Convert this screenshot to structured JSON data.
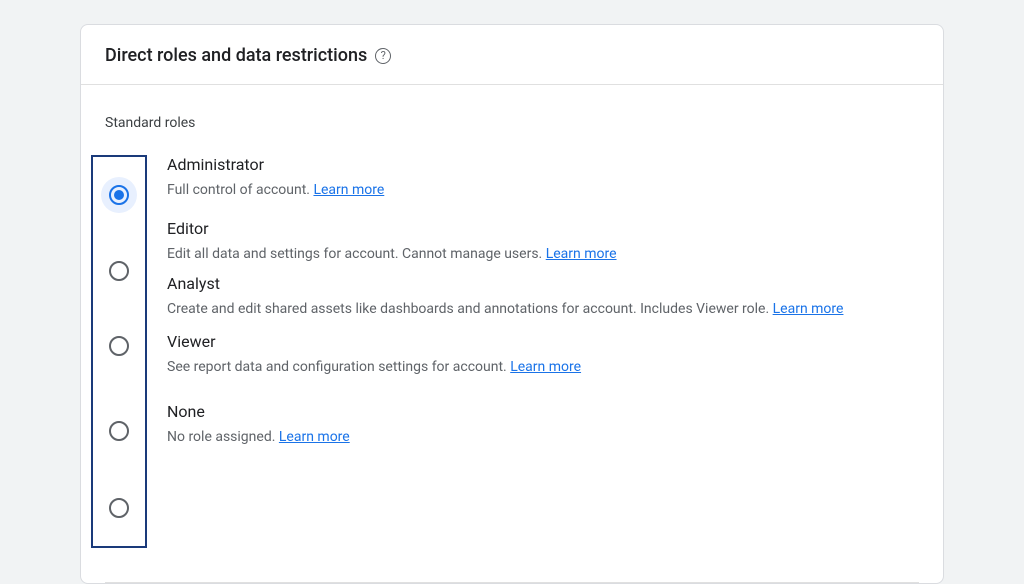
{
  "header": {
    "title": "Direct roles and data restrictions",
    "help_glyph": "?"
  },
  "section_label": "Standard roles",
  "learn_more_label": "Learn more",
  "roles": [
    {
      "title": "Administrator",
      "desc": "Full control of account.",
      "selected": true
    },
    {
      "title": "Editor",
      "desc": "Edit all data and settings for account. Cannot manage users.",
      "selected": false
    },
    {
      "title": "Analyst",
      "desc": "Create and edit shared assets like dashboards and annotations for account. Includes Viewer role.",
      "selected": false
    },
    {
      "title": "Viewer",
      "desc": "See report data and configuration settings for account.",
      "selected": false
    },
    {
      "title": "None",
      "desc": "No role assigned.",
      "selected": false
    }
  ],
  "radio_spacing": [
    0,
    40,
    39,
    49,
    41
  ]
}
